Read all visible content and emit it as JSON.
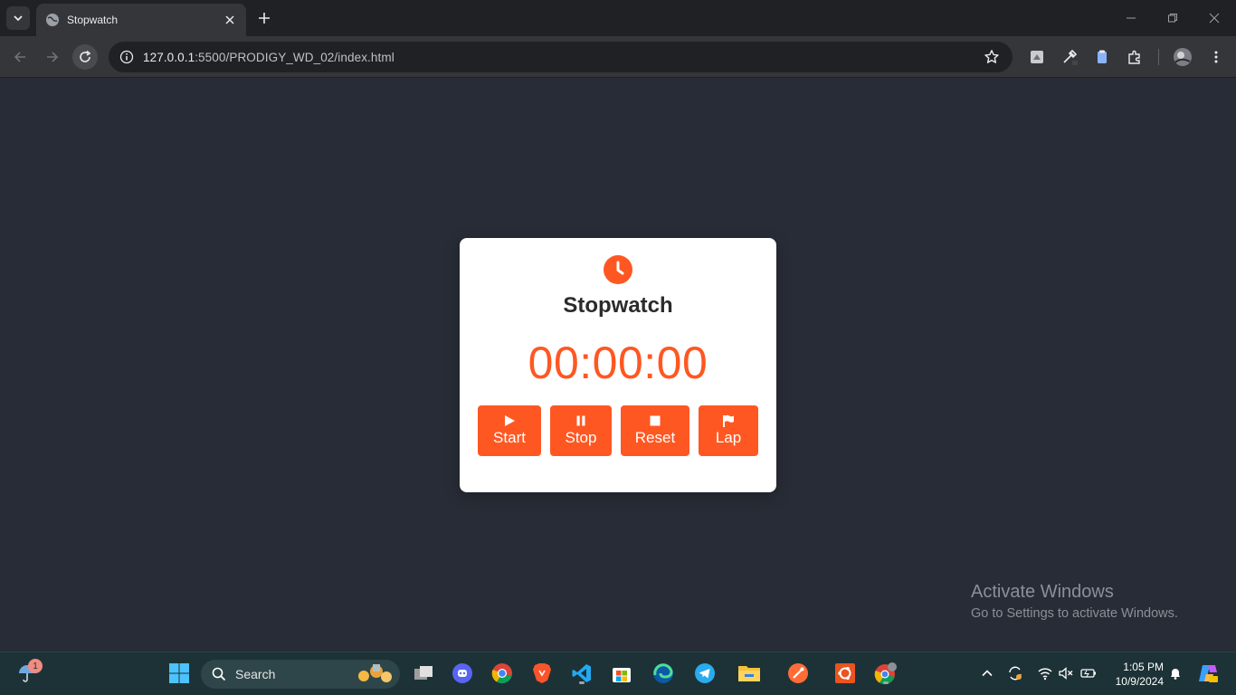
{
  "browser": {
    "tab_title": "Stopwatch",
    "url_host": "127.0.0.1",
    "url_rest": ":5500/PRODIGY_WD_02/index.html"
  },
  "app": {
    "title": "Stopwatch",
    "time": "00:00:00",
    "buttons": {
      "start": "Start",
      "stop": "Stop",
      "reset": "Reset",
      "lap": "Lap"
    },
    "accent_color": "#ff5722",
    "background_color": "#282c36"
  },
  "watermark": {
    "title": "Activate Windows",
    "subtitle": "Go to Settings to activate Windows."
  },
  "taskbar": {
    "search_label": "Search",
    "notification_count": "1",
    "time": "1:05 PM",
    "date": "10/9/2024"
  }
}
